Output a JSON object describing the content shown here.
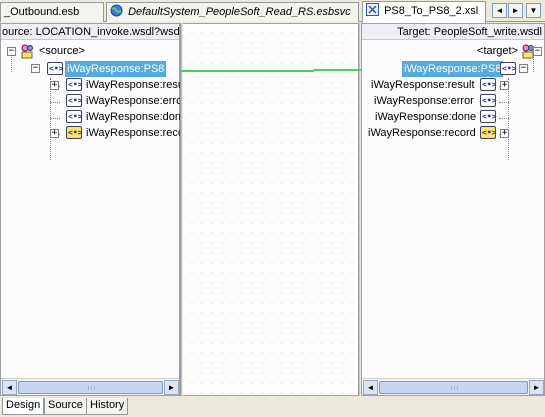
{
  "tabs": [
    {
      "label": "_Outbound.esb",
      "italic": false,
      "active": false
    },
    {
      "label": "DefaultSystem_PeopleSoft_Read_RS.esbsvc",
      "italic": true,
      "active": false
    },
    {
      "label": "PS8_To_PS8_2.xsl",
      "italic": false,
      "active": true
    }
  ],
  "tab_nav": {
    "back": "◄",
    "forward": "►",
    "menu": "▼"
  },
  "source_panel": {
    "header": "ource: LOCATION_invoke.wsdl?wsdl",
    "root": "<source>",
    "element": "iWayResponse:PS8",
    "children": [
      {
        "label": "iWayResponse:resu",
        "icon": "xml-element-icon",
        "expandable": true
      },
      {
        "label": "iWayResponse:errc",
        "icon": "xml-element-icon",
        "expandable": false
      },
      {
        "label": "iWayResponse:don",
        "icon": "xml-element-icon",
        "expandable": false
      },
      {
        "label": "iWayResponse:recc",
        "icon": "xml-record-icon",
        "expandable": true
      }
    ]
  },
  "target_panel": {
    "header": "Target: PeopleSoft_write.wsdl",
    "root": "<target>",
    "element": "iWayResponse:PS8",
    "children": [
      {
        "label": "iWayResponse:result",
        "icon": "xml-element-icon",
        "expandable": true
      },
      {
        "label": "iWayResponse:error",
        "icon": "xml-element-icon",
        "expandable": false
      },
      {
        "label": "iWayResponse:done",
        "icon": "xml-element-icon",
        "expandable": false
      },
      {
        "label": "iWayResponse:record",
        "icon": "xml-record-icon",
        "expandable": true
      }
    ]
  },
  "element_icon_text": "<•>",
  "bottom_tabs": [
    {
      "label": "Design",
      "active": true
    },
    {
      "label": "Source",
      "active": false
    },
    {
      "label": "History",
      "active": false
    }
  ],
  "scroll_arrows": {
    "left": "◄",
    "right": "►"
  },
  "colors": {
    "mapping_line": "#4ccf64",
    "selection": "#55aadd"
  }
}
